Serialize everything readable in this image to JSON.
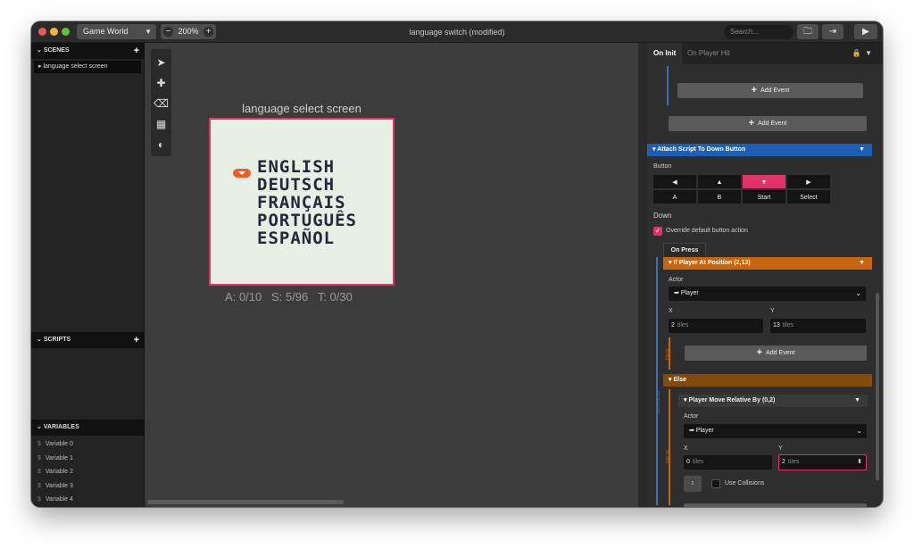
{
  "window": {
    "title": "language switch (modified)",
    "world_label": "Game World",
    "zoom": "200%",
    "search_placeholder": "Search..."
  },
  "left": {
    "scenes_title": "SCENES",
    "scene_items": [
      "language select screen"
    ],
    "scripts_title": "SCRIPTS",
    "variables_title": "VARIABLES",
    "variables": [
      "Variable 0",
      "Variable 1",
      "Variable 2",
      "Variable 3",
      "Variable 4"
    ]
  },
  "scene": {
    "title": "language select screen",
    "languages": [
      "ENGLISH",
      "DEUTSCH",
      "FRANÇAIS",
      "PORTUGUÊS",
      "ESPAÑOL"
    ],
    "stats": "A: 0/10   S: 5/96   T: 0/30"
  },
  "right": {
    "tab_on_init": "On Init",
    "tab_on_player_hit": "On Player Hit",
    "add_event": "Add Event",
    "attach_script": "Attach Script To Down Button",
    "button_label": "Button",
    "buttons": [
      "◀",
      "▲",
      "▼",
      "▶",
      "A",
      "B",
      "Start",
      "Select"
    ],
    "selected_button": "Down",
    "override_label": "Override default button action",
    "on_press_tab": "On Press",
    "if_player_at": "If Player At Position (2,13)",
    "actor_label": "Actor",
    "actor_value": "Player",
    "x_label": "X",
    "y_label": "Y",
    "x_value": "2",
    "y_value": "13",
    "tiles_unit": "tiles",
    "true_tag": "TRUE",
    "false_tag": "FALSE",
    "on_press_tag": "ON PRESS",
    "else_label": "Else",
    "move_relative": "Player Move Relative By (0,2)",
    "move_actor_value": "Player",
    "move_x_value": "0",
    "move_y_value": "2",
    "use_collisions": "Use Collisions"
  },
  "colors": {
    "accent": "#e0326b",
    "blue_header": "#1d5fb5",
    "orange_header": "#c8650f",
    "brown_header": "#86490c"
  }
}
